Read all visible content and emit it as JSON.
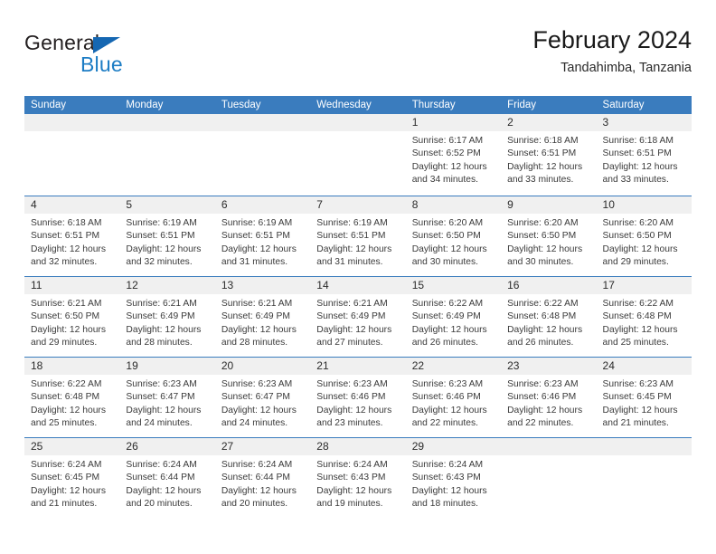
{
  "brand": {
    "name_part1": "General",
    "name_part2": "Blue",
    "triangle_icon": "triangle-icon",
    "accent_color": "#1567b2"
  },
  "header": {
    "title": "February 2024",
    "location": "Tandahimba, Tanzania"
  },
  "calendar": {
    "header_color": "#3a7cbe",
    "day_band_color": "#f0f0f0",
    "weekdays": [
      "Sunday",
      "Monday",
      "Tuesday",
      "Wednesday",
      "Thursday",
      "Friday",
      "Saturday"
    ],
    "weeks": [
      [
        {
          "day": "",
          "empty": true
        },
        {
          "day": "",
          "empty": true
        },
        {
          "day": "",
          "empty": true
        },
        {
          "day": "",
          "empty": true
        },
        {
          "day": "1",
          "sunrise": "Sunrise: 6:17 AM",
          "sunset": "Sunset: 6:52 PM",
          "daylight_line1": "Daylight: 12 hours",
          "daylight_line2": "and 34 minutes."
        },
        {
          "day": "2",
          "sunrise": "Sunrise: 6:18 AM",
          "sunset": "Sunset: 6:51 PM",
          "daylight_line1": "Daylight: 12 hours",
          "daylight_line2": "and 33 minutes."
        },
        {
          "day": "3",
          "sunrise": "Sunrise: 6:18 AM",
          "sunset": "Sunset: 6:51 PM",
          "daylight_line1": "Daylight: 12 hours",
          "daylight_line2": "and 33 minutes."
        }
      ],
      [
        {
          "day": "4",
          "sunrise": "Sunrise: 6:18 AM",
          "sunset": "Sunset: 6:51 PM",
          "daylight_line1": "Daylight: 12 hours",
          "daylight_line2": "and 32 minutes."
        },
        {
          "day": "5",
          "sunrise": "Sunrise: 6:19 AM",
          "sunset": "Sunset: 6:51 PM",
          "daylight_line1": "Daylight: 12 hours",
          "daylight_line2": "and 32 minutes."
        },
        {
          "day": "6",
          "sunrise": "Sunrise: 6:19 AM",
          "sunset": "Sunset: 6:51 PM",
          "daylight_line1": "Daylight: 12 hours",
          "daylight_line2": "and 31 minutes."
        },
        {
          "day": "7",
          "sunrise": "Sunrise: 6:19 AM",
          "sunset": "Sunset: 6:51 PM",
          "daylight_line1": "Daylight: 12 hours",
          "daylight_line2": "and 31 minutes."
        },
        {
          "day": "8",
          "sunrise": "Sunrise: 6:20 AM",
          "sunset": "Sunset: 6:50 PM",
          "daylight_line1": "Daylight: 12 hours",
          "daylight_line2": "and 30 minutes."
        },
        {
          "day": "9",
          "sunrise": "Sunrise: 6:20 AM",
          "sunset": "Sunset: 6:50 PM",
          "daylight_line1": "Daylight: 12 hours",
          "daylight_line2": "and 30 minutes."
        },
        {
          "day": "10",
          "sunrise": "Sunrise: 6:20 AM",
          "sunset": "Sunset: 6:50 PM",
          "daylight_line1": "Daylight: 12 hours",
          "daylight_line2": "and 29 minutes."
        }
      ],
      [
        {
          "day": "11",
          "sunrise": "Sunrise: 6:21 AM",
          "sunset": "Sunset: 6:50 PM",
          "daylight_line1": "Daylight: 12 hours",
          "daylight_line2": "and 29 minutes."
        },
        {
          "day": "12",
          "sunrise": "Sunrise: 6:21 AM",
          "sunset": "Sunset: 6:49 PM",
          "daylight_line1": "Daylight: 12 hours",
          "daylight_line2": "and 28 minutes."
        },
        {
          "day": "13",
          "sunrise": "Sunrise: 6:21 AM",
          "sunset": "Sunset: 6:49 PM",
          "daylight_line1": "Daylight: 12 hours",
          "daylight_line2": "and 28 minutes."
        },
        {
          "day": "14",
          "sunrise": "Sunrise: 6:21 AM",
          "sunset": "Sunset: 6:49 PM",
          "daylight_line1": "Daylight: 12 hours",
          "daylight_line2": "and 27 minutes."
        },
        {
          "day": "15",
          "sunrise": "Sunrise: 6:22 AM",
          "sunset": "Sunset: 6:49 PM",
          "daylight_line1": "Daylight: 12 hours",
          "daylight_line2": "and 26 minutes."
        },
        {
          "day": "16",
          "sunrise": "Sunrise: 6:22 AM",
          "sunset": "Sunset: 6:48 PM",
          "daylight_line1": "Daylight: 12 hours",
          "daylight_line2": "and 26 minutes."
        },
        {
          "day": "17",
          "sunrise": "Sunrise: 6:22 AM",
          "sunset": "Sunset: 6:48 PM",
          "daylight_line1": "Daylight: 12 hours",
          "daylight_line2": "and 25 minutes."
        }
      ],
      [
        {
          "day": "18",
          "sunrise": "Sunrise: 6:22 AM",
          "sunset": "Sunset: 6:48 PM",
          "daylight_line1": "Daylight: 12 hours",
          "daylight_line2": "and 25 minutes."
        },
        {
          "day": "19",
          "sunrise": "Sunrise: 6:23 AM",
          "sunset": "Sunset: 6:47 PM",
          "daylight_line1": "Daylight: 12 hours",
          "daylight_line2": "and 24 minutes."
        },
        {
          "day": "20",
          "sunrise": "Sunrise: 6:23 AM",
          "sunset": "Sunset: 6:47 PM",
          "daylight_line1": "Daylight: 12 hours",
          "daylight_line2": "and 24 minutes."
        },
        {
          "day": "21",
          "sunrise": "Sunrise: 6:23 AM",
          "sunset": "Sunset: 6:46 PM",
          "daylight_line1": "Daylight: 12 hours",
          "daylight_line2": "and 23 minutes."
        },
        {
          "day": "22",
          "sunrise": "Sunrise: 6:23 AM",
          "sunset": "Sunset: 6:46 PM",
          "daylight_line1": "Daylight: 12 hours",
          "daylight_line2": "and 22 minutes."
        },
        {
          "day": "23",
          "sunrise": "Sunrise: 6:23 AM",
          "sunset": "Sunset: 6:46 PM",
          "daylight_line1": "Daylight: 12 hours",
          "daylight_line2": "and 22 minutes."
        },
        {
          "day": "24",
          "sunrise": "Sunrise: 6:23 AM",
          "sunset": "Sunset: 6:45 PM",
          "daylight_line1": "Daylight: 12 hours",
          "daylight_line2": "and 21 minutes."
        }
      ],
      [
        {
          "day": "25",
          "sunrise": "Sunrise: 6:24 AM",
          "sunset": "Sunset: 6:45 PM",
          "daylight_line1": "Daylight: 12 hours",
          "daylight_line2": "and 21 minutes."
        },
        {
          "day": "26",
          "sunrise": "Sunrise: 6:24 AM",
          "sunset": "Sunset: 6:44 PM",
          "daylight_line1": "Daylight: 12 hours",
          "daylight_line2": "and 20 minutes."
        },
        {
          "day": "27",
          "sunrise": "Sunrise: 6:24 AM",
          "sunset": "Sunset: 6:44 PM",
          "daylight_line1": "Daylight: 12 hours",
          "daylight_line2": "and 20 minutes."
        },
        {
          "day": "28",
          "sunrise": "Sunrise: 6:24 AM",
          "sunset": "Sunset: 6:43 PM",
          "daylight_line1": "Daylight: 12 hours",
          "daylight_line2": "and 19 minutes."
        },
        {
          "day": "29",
          "sunrise": "Sunrise: 6:24 AM",
          "sunset": "Sunset: 6:43 PM",
          "daylight_line1": "Daylight: 12 hours",
          "daylight_line2": "and 18 minutes."
        },
        {
          "day": "",
          "empty": true
        },
        {
          "day": "",
          "empty": true
        }
      ]
    ]
  }
}
